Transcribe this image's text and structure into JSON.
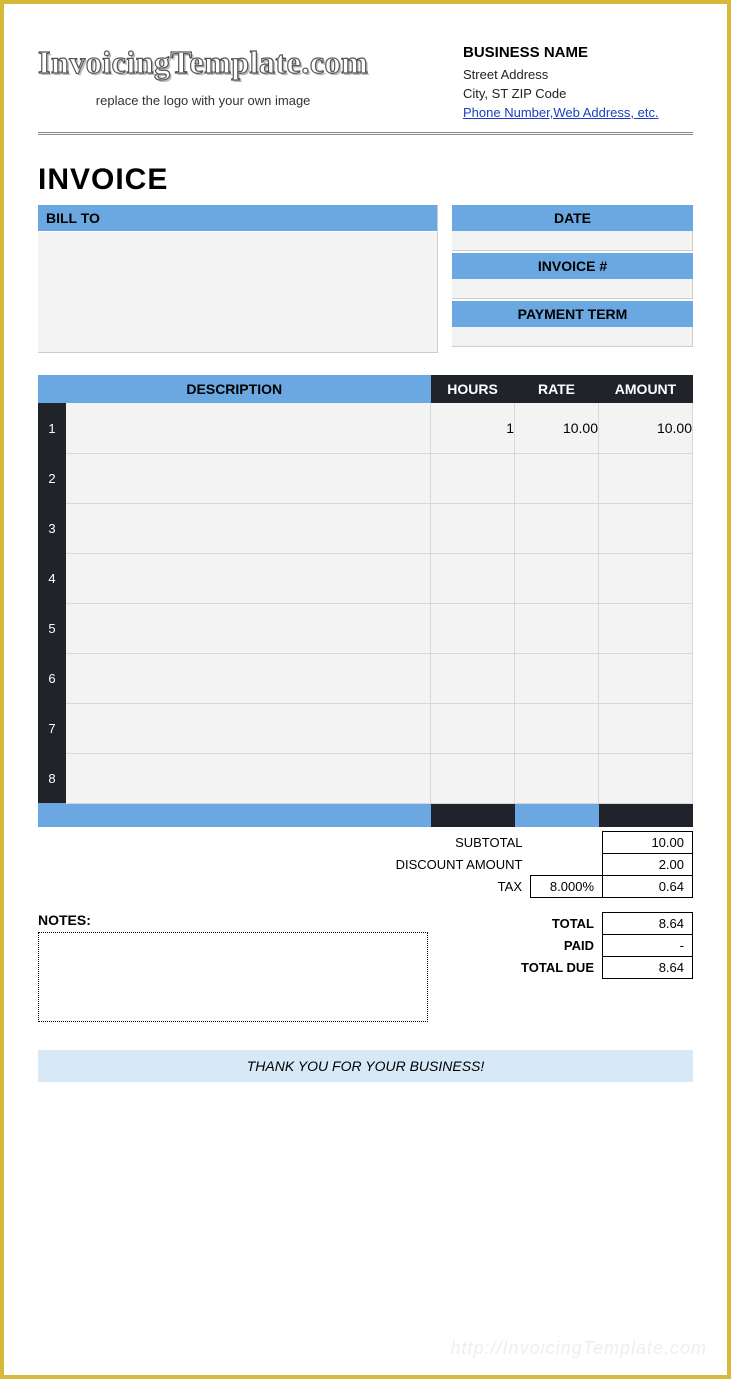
{
  "header": {
    "logo_text": "InvoicingTemplate.com",
    "logo_caption": "replace the logo with your own image",
    "business_name": "BUSINESS NAME",
    "street": "Street Address",
    "city_line": "City, ST  ZIP Code",
    "contact_link": "Phone Number,Web Address, etc."
  },
  "title": "INVOICE",
  "billto_label": "BILL TO",
  "meta": {
    "date_label": "DATE",
    "date_value": "",
    "invoice_num_label": "INVOICE #",
    "invoice_num_value": "",
    "payment_term_label": "PAYMENT TERM",
    "payment_term_value": ""
  },
  "columns": {
    "desc": "DESCRIPTION",
    "hours": "HOURS",
    "rate": "RATE",
    "amount": "AMOUNT"
  },
  "rows": [
    {
      "n": "1",
      "desc": "",
      "hours": "1",
      "rate": "10.00",
      "amount": "10.00"
    },
    {
      "n": "2",
      "desc": "",
      "hours": "",
      "rate": "",
      "amount": ""
    },
    {
      "n": "3",
      "desc": "",
      "hours": "",
      "rate": "",
      "amount": ""
    },
    {
      "n": "4",
      "desc": "",
      "hours": "",
      "rate": "",
      "amount": ""
    },
    {
      "n": "5",
      "desc": "",
      "hours": "",
      "rate": "",
      "amount": ""
    },
    {
      "n": "6",
      "desc": "",
      "hours": "",
      "rate": "",
      "amount": ""
    },
    {
      "n": "7",
      "desc": "",
      "hours": "",
      "rate": "",
      "amount": ""
    },
    {
      "n": "8",
      "desc": "",
      "hours": "",
      "rate": "",
      "amount": ""
    }
  ],
  "summary": {
    "subtotal_label": "SUBTOTAL",
    "subtotal": "10.00",
    "discount_label": "DISCOUNT AMOUNT",
    "discount": "2.00",
    "tax_label": "TAX",
    "tax_pct": "8.000%",
    "tax": "0.64"
  },
  "notes_label": "NOTES:",
  "totals": {
    "total_label": "TOTAL",
    "total": "8.64",
    "paid_label": "PAID",
    "paid": "-",
    "due_label": "TOTAL DUE",
    "due": "8.64"
  },
  "thanks": "THANK YOU FOR YOUR BUSINESS!",
  "watermark": "http://InvoicingTemplate.com"
}
